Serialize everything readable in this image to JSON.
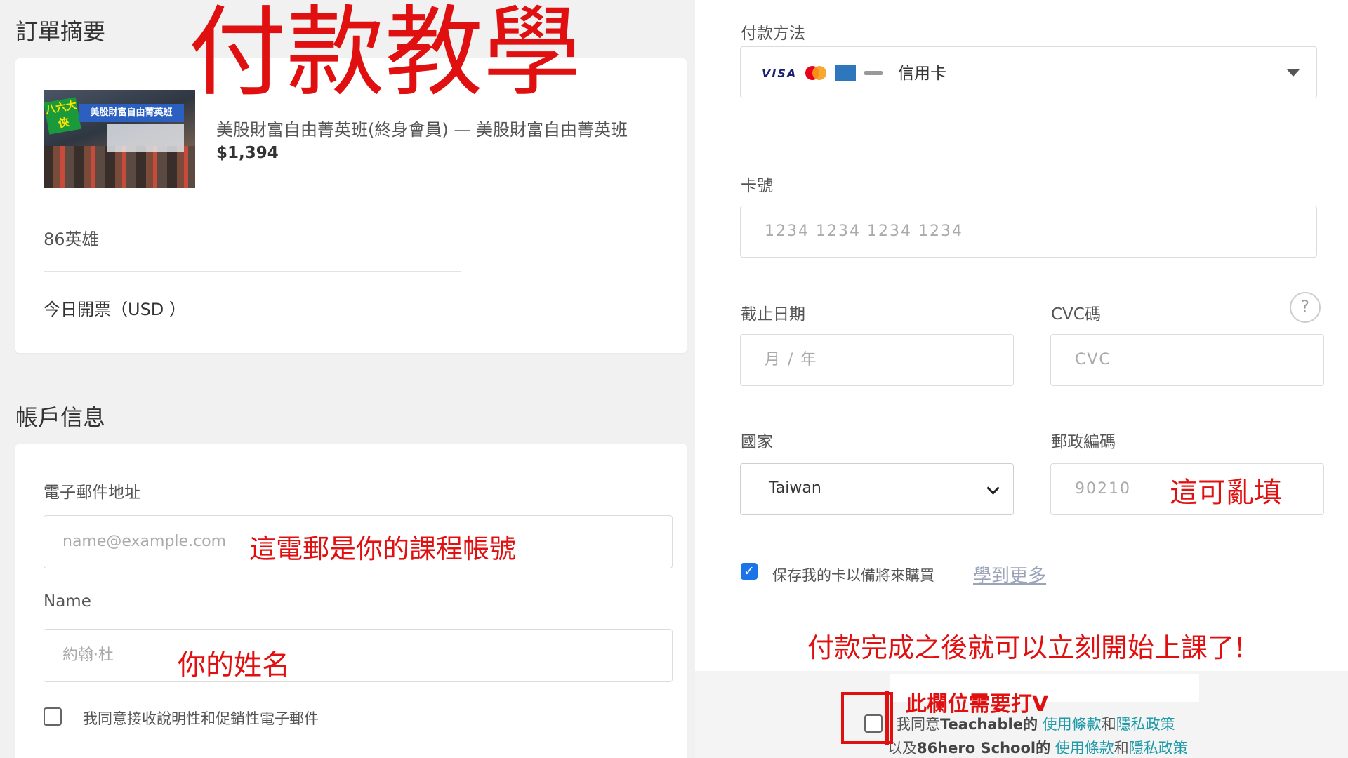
{
  "order_summary": {
    "title": "訂單摘要",
    "product_name": "美股財富自由菁英班(終身會員) — 美股財富自由菁英班",
    "product_price": "$1,394",
    "thumbnail": {
      "badge": "八六大俠",
      "banner": "美股財富自由菁英班"
    },
    "seller": "86英雄",
    "today_charge": "今日開票（USD ）"
  },
  "account": {
    "title": "帳戶信息",
    "email_label": "電子郵件地址",
    "email_placeholder": "name@example.com",
    "name_label": "Name",
    "name_placeholder": "約翰·杜",
    "promo_label": "我同意接收說明性和促銷性電子郵件",
    "promo_checked": false
  },
  "payment": {
    "method_label": "付款方法",
    "method_value": "信用卡",
    "card_logos": [
      "VISA",
      "mastercard",
      "amex",
      "other"
    ],
    "card_number_label": "卡號",
    "card_number_placeholder": "1234 1234 1234 1234",
    "expiry_label": "截止日期",
    "expiry_placeholder": "月 / 年",
    "cvc_label": "CVC碼",
    "cvc_placeholder": "CVC",
    "help_icon": "?",
    "country_label": "國家",
    "country_value": "Taiwan",
    "zip_label": "郵政編碼",
    "zip_placeholder": "90210",
    "save_card_label": "保存我的卡以備將來購買",
    "save_card_checked": true,
    "learn_more": "學到更多"
  },
  "terms": {
    "line1_prefix": "我同意",
    "line1_brand": "Teachable的",
    "terms_link": "使用條款",
    "and": "和",
    "privacy_link": "隱私政策",
    "line2_prefix": "以及",
    "line2_brand": "86hero School的",
    "checked": false
  },
  "annotations": {
    "title": "付款教學",
    "email_note": "這電郵是你的課程帳號",
    "name_note": "你的姓名",
    "zip_note": "這可亂填",
    "done_note": "付款完成之後就可以立刻開始上課了!",
    "check_note": "此欄位需要打V"
  },
  "colors": {
    "annotation_red": "#e01010",
    "link_teal": "#1e9aa8",
    "checkbox_blue": "#1a73e8"
  }
}
